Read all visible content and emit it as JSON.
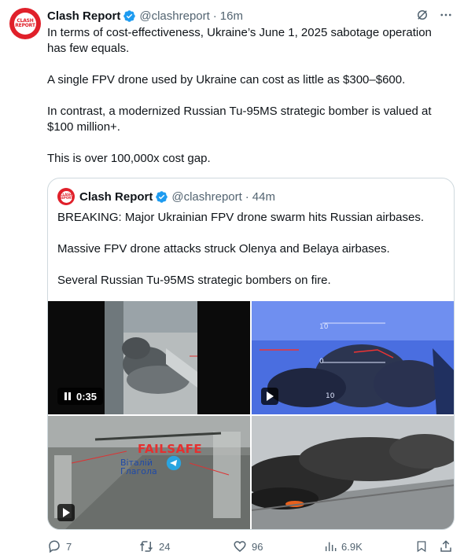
{
  "post": {
    "author_name": "Clash Report",
    "author_handle": "@clashreport",
    "separator": "·",
    "time": "16m",
    "avatar_text_1": "CLASH",
    "avatar_text_2": "REPORT",
    "paragraphs": [
      "In terms of cost-effectiveness, Ukraine’s June 1, 2025 sabotage operation has few equals.",
      "A single FPV drone used by Ukraine can cost as little as $300–$600.",
      "In contrast, a modernized Russian Tu-95MS strategic bomber is valued at $100 million+.",
      "This is over 100,000x cost gap."
    ]
  },
  "quote": {
    "author_name": "Clash Report",
    "author_handle": "@clashreport",
    "separator": "·",
    "time": "44m",
    "paragraphs": [
      "BREAKING: Major Ukrainian FPV drone swarm hits Russian airbases.",
      "Massive FPV drone attacks struck Olenya and Belaya airbases.",
      "Several Russian Tu-95MS strategic bombers on fire."
    ],
    "media": {
      "video_duration": "0:35",
      "watermark_1": "FAILSAFE",
      "watermark_2a": "Віталій",
      "watermark_2b": "Глагола",
      "hud_10_top": "10",
      "hud_0": "0",
      "hud_10_bottom": "10"
    }
  },
  "actions": {
    "replies": "7",
    "reposts": "24",
    "likes": "96",
    "views": "6.9K"
  },
  "colors": {
    "brand_red": "#e0202a",
    "verified_blue": "#1d9bf0",
    "secondary_text": "#536471",
    "border": "#cfd9de"
  }
}
